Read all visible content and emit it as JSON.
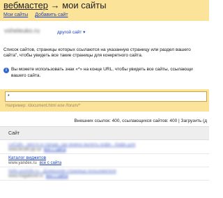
{
  "header": {
    "title_link": "вебмастер",
    "title_arrow": "→",
    "title_rest": "мои сайты",
    "links": [
      "Мои сайты",
      "Добавить сайт"
    ]
  },
  "site": {
    "name": "vsheleuko.ru",
    "other_site": "другой сайт ▾"
  },
  "description": [
    "Список сайтов, страницы которых ссылаются на указанную страницу или раздел вашего",
    "сайта\", чтобы увидеть все такие страницы для конкретного сайта."
  ],
  "tip": {
    "icon": "i",
    "line1": "Вы можете использовать знак «*» на конце URL, чтобы увидеть все сайты, ссылающи",
    "line2": "вашего сайта."
  },
  "filter": {
    "value": "*",
    "hint": "Например: /document.html или /forum/*"
  },
  "stats": "Внешних ссылок: 400, ссылающихся сайтов: 400 | Загрузить (д",
  "table": {
    "column": "Сайт",
    "rows": [
      {
        "anchor": "LeCafe - место в городе, где можно выпить кофе - Кафе для",
        "url": "www.lecafe.pp.ua",
        "all": "все с сайта",
        "blurred": true
      },
      {
        "anchor": "Каталог виджетов",
        "url": "www.yandex.ru",
        "all": "все с сайта",
        "blurred": false
      },
      {
        "anchor": "hello.yoolofe.ru - Домашняя страница пользователя",
        "url": "www.magalisvet.ru",
        "all": "все с сайта",
        "blurred": true
      }
    ]
  },
  "colors": {
    "band": "#fbe39a",
    "link": "#1a3dc1",
    "header_row": "#eeeeee"
  }
}
